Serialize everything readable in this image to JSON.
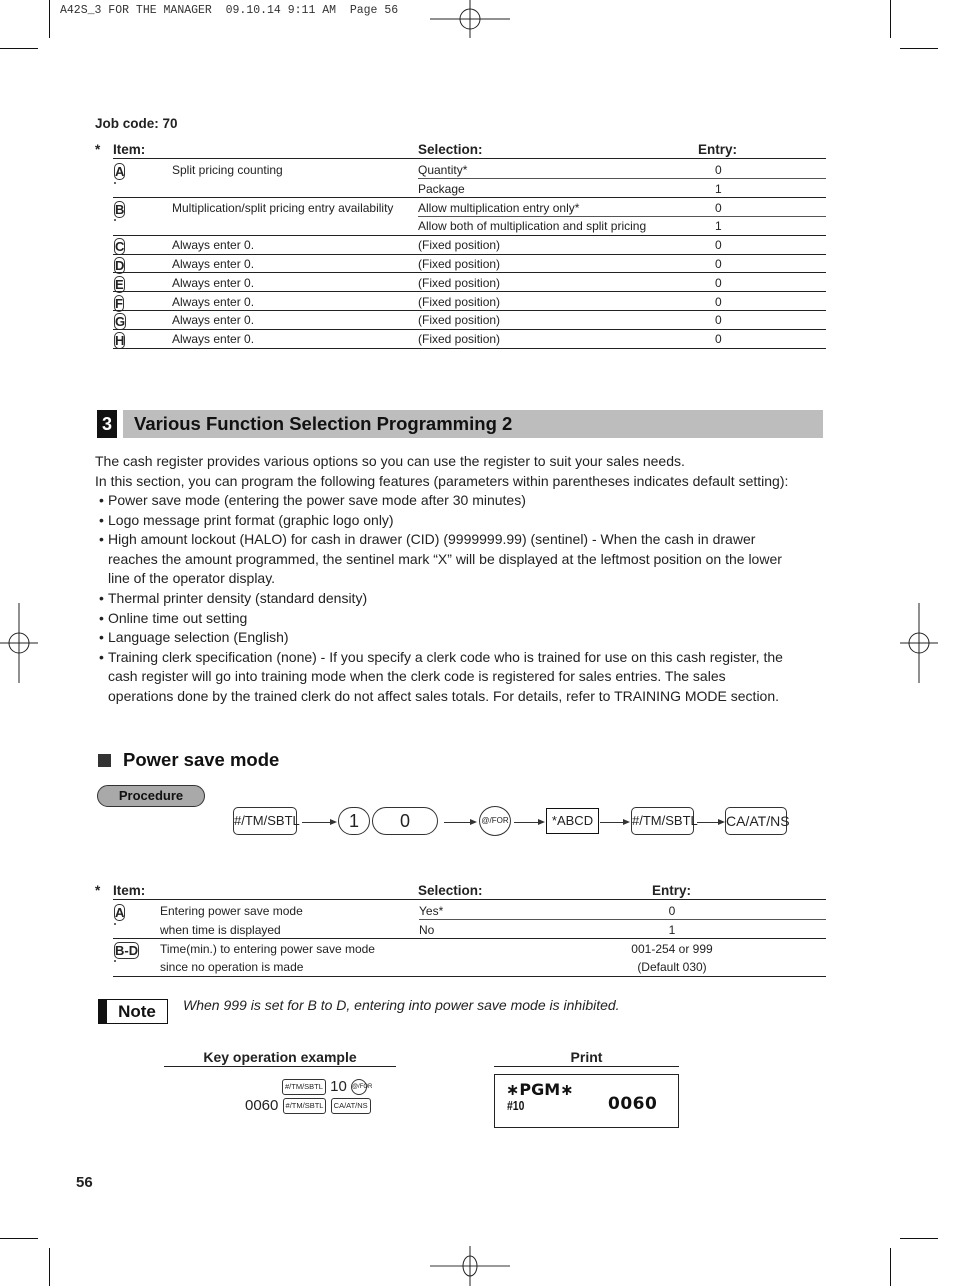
{
  "slug": "A42S_3 FOR THE MANAGER  09.10.14 9:11 AM  Page 56",
  "job_code": "Job code:  70",
  "table1": {
    "star": "*",
    "headers": {
      "item": "Item:",
      "selection": "Selection:",
      "entry": "Entry:"
    },
    "rows": [
      {
        "key": "A",
        "item": "Split pricing counting",
        "selection": "Quantity*",
        "entry": "0"
      },
      {
        "key": "",
        "item": "",
        "selection": "Package",
        "entry": "1"
      },
      {
        "key": "B",
        "item": "Multiplication/split pricing entry availability",
        "selection": "Allow multiplication entry only*",
        "entry": "0"
      },
      {
        "key": "",
        "item": "",
        "selection": "Allow both of multiplication and split pricing",
        "entry": "1"
      },
      {
        "key": "C",
        "item": "Always enter 0.",
        "selection": "(Fixed position)",
        "entry": "0"
      },
      {
        "key": "D",
        "item": "Always enter 0.",
        "selection": "(Fixed position)",
        "entry": "0"
      },
      {
        "key": "E",
        "item": "Always enter 0.",
        "selection": "(Fixed position)",
        "entry": "0"
      },
      {
        "key": "F",
        "item": "Always enter 0.",
        "selection": "(Fixed position)",
        "entry": "0"
      },
      {
        "key": "G",
        "item": "Always enter 0.",
        "selection": "(Fixed position)",
        "entry": "0"
      },
      {
        "key": "H",
        "item": "Always enter 0.",
        "selection": "(Fixed position)",
        "entry": "0"
      }
    ]
  },
  "section": {
    "number": "3",
    "title": "Various Function Selection Programming 2",
    "intro1": "The cash register provides various options so you can use the register to suit your sales needs.",
    "intro2": "In this section, you can program the following features (parameters within parentheses indicates default setting):",
    "bullets": [
      {
        "line1": "Power save mode (entering the power save mode after 30 minutes)"
      },
      {
        "line1": "Logo message print format (graphic logo only)"
      },
      {
        "line1": "High amount lockout (HALO) for cash in drawer (CID) (9999999.99) (sentinel) - When the cash in drawer",
        "line2": "reaches the amount programmed, the sentinel mark “X” will be displayed at the leftmost position on the lower",
        "line3": "line of the operator display."
      },
      {
        "line1": "Thermal printer density (standard density)"
      },
      {
        "line1": "Online time out setting"
      },
      {
        "line1": "Language selection (English)"
      },
      {
        "line1": "Training clerk specification (none) - If you specify a clerk code who is trained for use on this cash register, the",
        "line2": "cash register will go into training mode when the clerk code is registered for sales entries.  The sales",
        "line3": "operations done by the trained clerk do not affect sales totals.  For details, refer to TRAINING MODE section."
      }
    ]
  },
  "power_save": {
    "title": "Power save mode",
    "procedure_label": "Procedure",
    "flow": {
      "key1": "#/TM/SBTL",
      "digit1": "1",
      "digit2": "0",
      "key2": "@/FOR",
      "box": "*ABCD",
      "key3": "#/TM/SBTL",
      "key4": "CA/AT/NS"
    },
    "table": {
      "star": "*",
      "headers": {
        "item": "Item:",
        "selection": "Selection:",
        "entry": "Entry:"
      },
      "rows": [
        {
          "key": "A",
          "item": "Entering power save mode",
          "selection": "Yes*",
          "entry": "0"
        },
        {
          "key": "",
          "item": "when time is displayed",
          "selection": "No",
          "entry": "1"
        },
        {
          "key": "B-D",
          "item": "Time(min.) to entering power save mode",
          "selection": "",
          "entry": "001-254 or 999"
        },
        {
          "key": "",
          "item": "since no operation is made",
          "selection": "",
          "entry": "(Default 030)"
        }
      ]
    },
    "note_label": "Note",
    "note_text": "When 999 is set for B to D, entering into power save mode is inhibited.",
    "example": {
      "header": "Key operation example",
      "line1_key": "#/TM/SBTL",
      "line1_num": "10",
      "line1_circ": "@/FOR",
      "line2_num": "0060",
      "line2_key1": "#/TM/SBTL",
      "line2_key2": "CA/AT/NS"
    },
    "print": {
      "header": "Print",
      "line1": "∗PGM∗",
      "line2_left": "#10",
      "line2_right": "0060"
    }
  },
  "page_number": "56"
}
